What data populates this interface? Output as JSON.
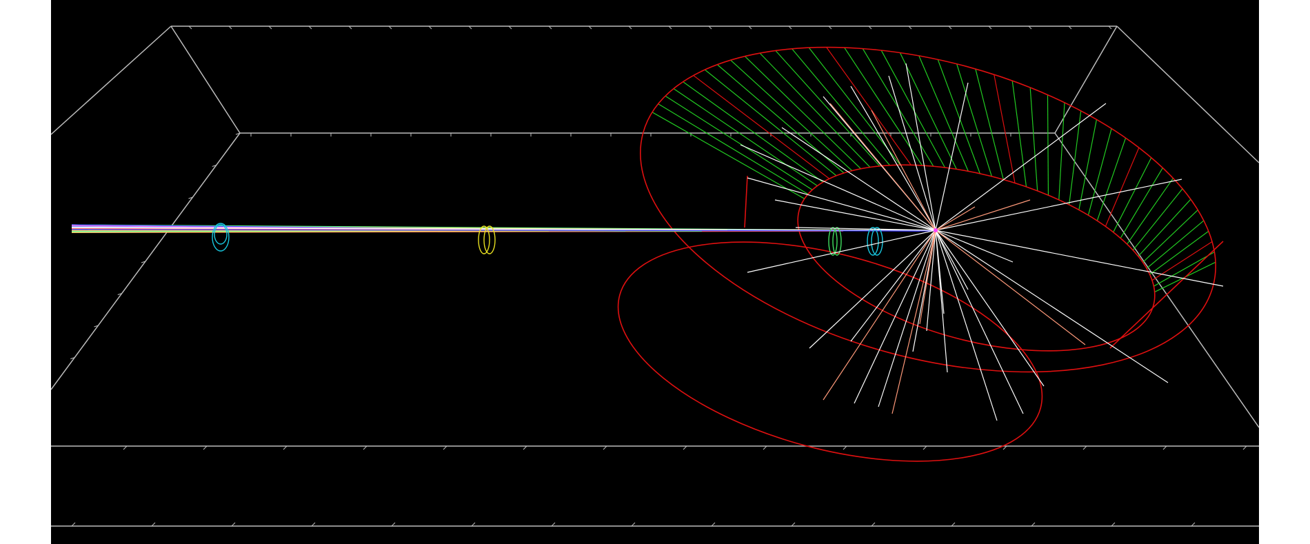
{
  "viewer": {
    "background_color": "#000000",
    "page_color": "#ffffff",
    "colors": {
      "grid": "#bdbdbd",
      "calorimeter_outline": "#e01010",
      "calorimeter_cells": "#22cc22",
      "tracks_primary": "#ffffff",
      "tracks_secondary": "#ff9a7a",
      "beam_bundle": [
        "#ff80ff",
        "#80a0ff",
        "#ffffff",
        "#ff6060",
        "#60ff90",
        "#ffd060",
        "#4040ff"
      ],
      "station_cyan": "#18c8e0",
      "station_yellow": "#e8e020",
      "station_green": "#40e060",
      "vertex": "#ff40ff"
    }
  },
  "scene": {
    "objects": [
      {
        "name": "bounding-grid-box",
        "kind": "wireframe"
      },
      {
        "name": "beam-pipe-tracks",
        "kind": "track-bundle"
      },
      {
        "name": "detector-station-1",
        "kind": "ring",
        "color": "cyan"
      },
      {
        "name": "detector-station-2",
        "kind": "ring",
        "color": "yellow"
      },
      {
        "name": "detector-station-3",
        "kind": "ring",
        "color": "green"
      },
      {
        "name": "detector-station-4",
        "kind": "ring",
        "color": "cyan"
      },
      {
        "name": "calorimeter-cylinder",
        "kind": "cylinder"
      },
      {
        "name": "interaction-vertex",
        "kind": "point"
      },
      {
        "name": "particle-spray",
        "kind": "track-bundle"
      }
    ]
  }
}
